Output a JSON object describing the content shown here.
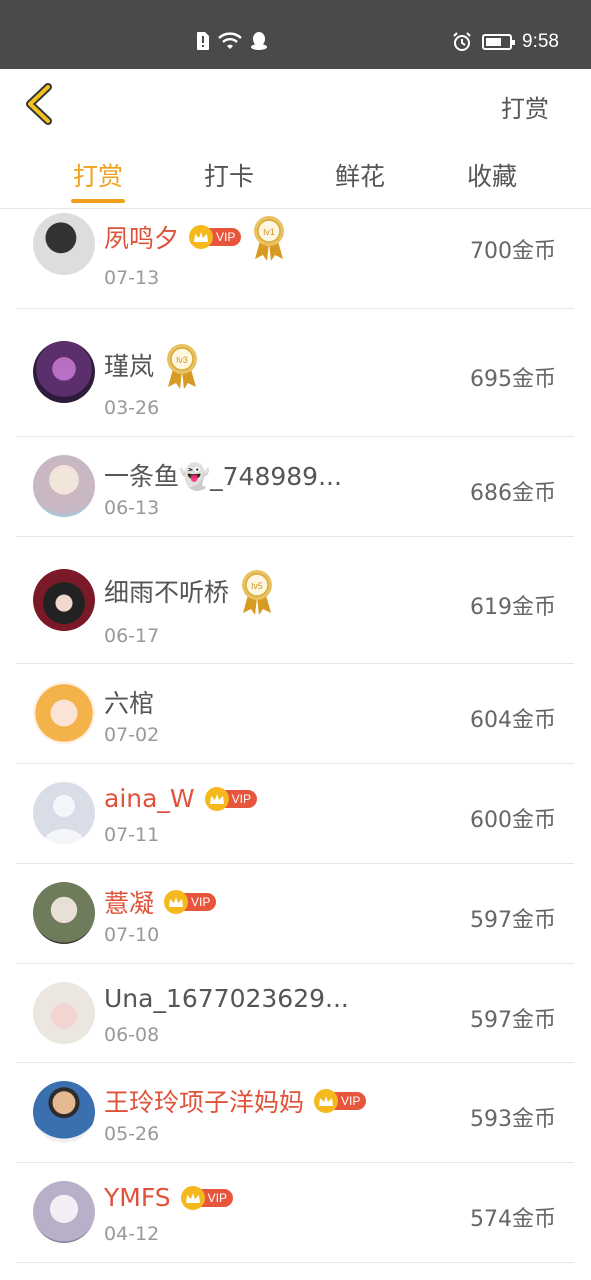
{
  "status_bar": {
    "time": "9:58"
  },
  "nav": {
    "action_label": "打赏"
  },
  "tabs": [
    {
      "label": "打赏",
      "active": true
    },
    {
      "label": "打卡",
      "active": false
    },
    {
      "label": "鲜花",
      "active": false
    },
    {
      "label": "收藏",
      "active": false
    }
  ],
  "vip_label": "VIP",
  "list": [
    {
      "name": "夙鸣夕",
      "vip": true,
      "level": "lv1",
      "date": "07-13",
      "coins": "700金币"
    },
    {
      "name": "瑾岚",
      "vip": false,
      "level": "lv3",
      "date": "03-26",
      "coins": "695金币"
    },
    {
      "name": "一条鱼👻_748989...",
      "vip": false,
      "level": "",
      "date": "06-13",
      "coins": "686金币"
    },
    {
      "name": "细雨不听桥",
      "vip": false,
      "level": "lv5",
      "date": "06-17",
      "coins": "619金币"
    },
    {
      "name": "六棺",
      "vip": false,
      "level": "",
      "date": "07-02",
      "coins": "604金币"
    },
    {
      "name": "aina_W",
      "vip": true,
      "level": "",
      "date": "07-11",
      "coins": "600金币"
    },
    {
      "name": "薏凝",
      "vip": true,
      "level": "",
      "date": "07-10",
      "coins": "597金币"
    },
    {
      "name": "Una_1677023629...",
      "vip": false,
      "level": "",
      "date": "06-08",
      "coins": "597金币"
    },
    {
      "name": "王玲玲项子洋妈妈",
      "vip": true,
      "level": "",
      "date": "05-26",
      "coins": "593金币"
    },
    {
      "name": "YMFS",
      "vip": true,
      "level": "",
      "date": "04-12",
      "coins": "574金币"
    }
  ],
  "colors": {
    "accent": "#f2a01b",
    "vip_name": "#e0523a",
    "status_bar": "#4a4a4a"
  }
}
